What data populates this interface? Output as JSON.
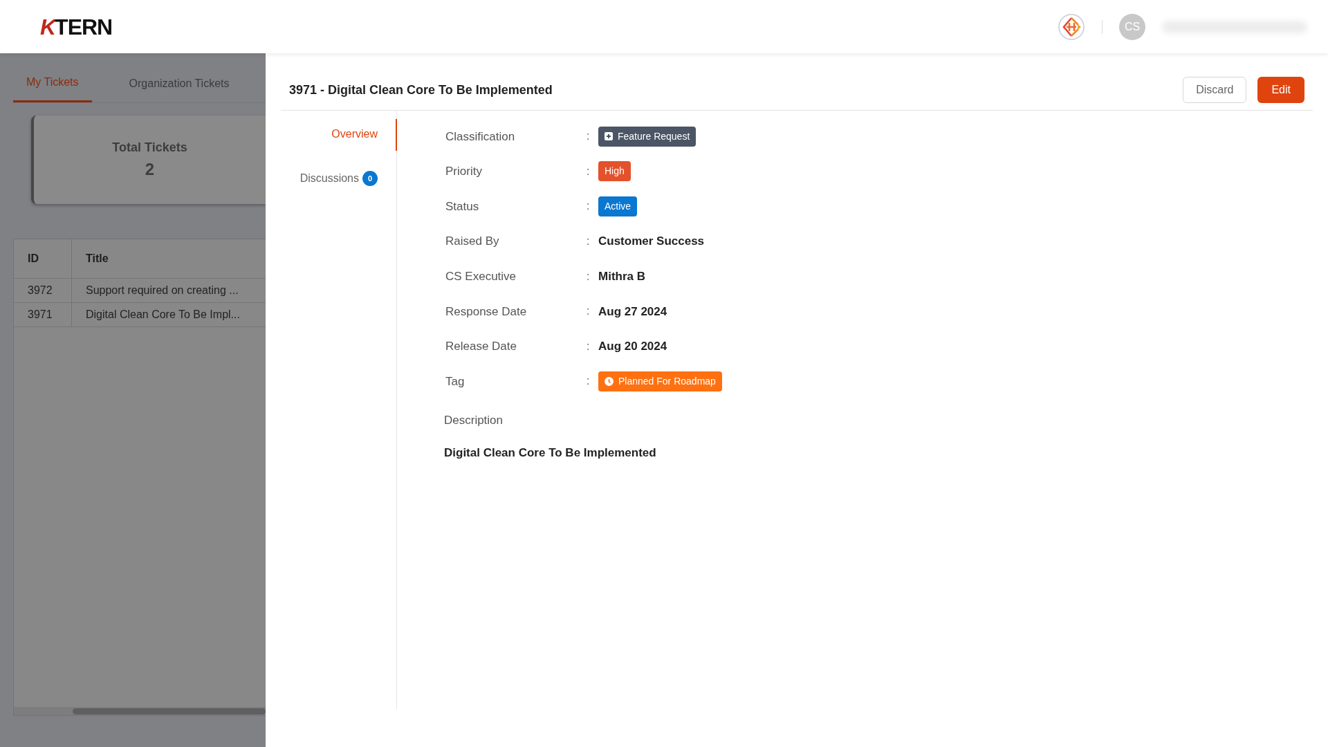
{
  "header": {
    "logo": {
      "mark": "K",
      "text": "TERN"
    },
    "avatar": "CS"
  },
  "ticket_tabs": [
    {
      "label": "My Tickets",
      "selected": true
    },
    {
      "label": "Organization Tickets",
      "selected": false
    }
  ],
  "summary": {
    "label": "Total Tickets",
    "value": "2"
  },
  "table": {
    "columns": [
      "ID",
      "Title"
    ],
    "rows": [
      [
        "3972",
        "Support required on creating ..."
      ],
      [
        "3971",
        "Digital Clean Core To Be Impl..."
      ]
    ]
  },
  "detail": {
    "title": "3971 - Digital Clean Core To Be Implemented",
    "buttons": [
      {
        "label": "Discard",
        "kind": "secondary"
      },
      {
        "label": "Edit",
        "kind": "primary"
      }
    ],
    "nav": [
      {
        "label": "Overview",
        "selected": true
      },
      {
        "label": "Discussions",
        "selected": false,
        "count": "0"
      }
    ],
    "fields": [
      {
        "label": "Classification",
        "colon": ":",
        "kind": "category",
        "value": "Feature Request",
        "color": "#4b5565"
      },
      {
        "label": "Priority",
        "colon": ":",
        "kind": "badge",
        "value": "High",
        "color": "#e4512a"
      },
      {
        "label": "Status",
        "colon": ":",
        "kind": "badge",
        "value": "Active",
        "color": "#0a77d0"
      },
      {
        "label": "Raised By",
        "colon": ":",
        "kind": "text",
        "value": "Customer Success"
      },
      {
        "label": "CS Executive",
        "colon": ":",
        "kind": "text",
        "value": "Mithra B"
      },
      {
        "label": "Response Date",
        "colon": ":",
        "kind": "text",
        "value": "Aug 27 2024"
      },
      {
        "label": "Release Date",
        "colon": ":",
        "kind": "text",
        "value": "Aug 20 2024"
      },
      {
        "label": "Tag",
        "colon": ":",
        "kind": "tag",
        "value": "Planned For Roadmap",
        "color": "#ff7010"
      }
    ],
    "description": {
      "label": "Description",
      "text": "Digital Clean Core To Be Implemented"
    }
  }
}
